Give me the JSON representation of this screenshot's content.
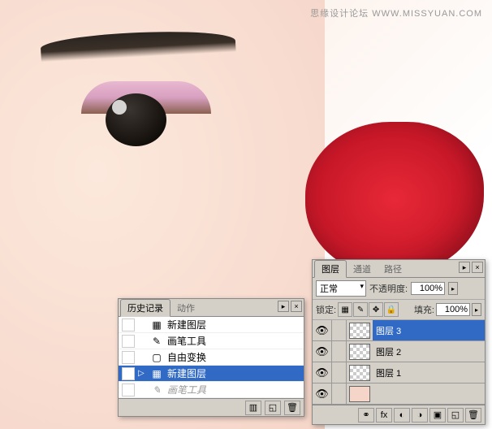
{
  "watermark": "思缘设计论坛  WWW.MISSYUAN.COM",
  "history": {
    "tabs": {
      "history": "历史记录",
      "actions": "动作"
    },
    "items": [
      {
        "icon": "new-layer",
        "label": "新建图层"
      },
      {
        "icon": "brush",
        "label": "画笔工具"
      },
      {
        "icon": "transform",
        "label": "自由变换"
      },
      {
        "icon": "new-layer",
        "label": "新建图层"
      },
      {
        "icon": "brush",
        "label": "画笔工具"
      }
    ]
  },
  "layers": {
    "tabs": {
      "layers": "图层",
      "channels": "通道",
      "paths": "路径"
    },
    "blend_mode": "正常",
    "opacity_label": "不透明度:",
    "opacity_value": "100%",
    "lock_label": "锁定:",
    "fill_label": "填充:",
    "fill_value": "100%",
    "items": [
      {
        "name": "图层 3"
      },
      {
        "name": "图层 2"
      },
      {
        "name": "图层 1"
      },
      {
        "name": ""
      }
    ]
  }
}
